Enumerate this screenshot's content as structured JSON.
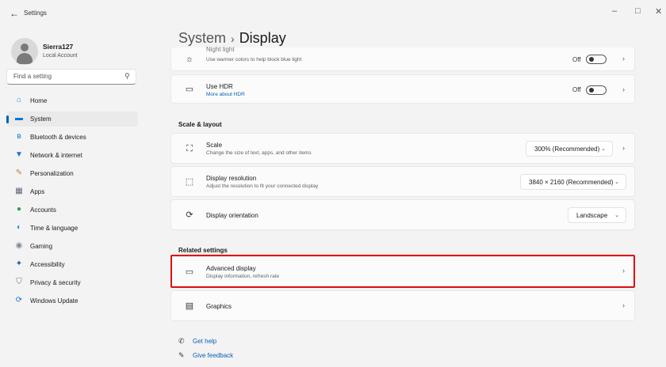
{
  "window": {
    "title": "Settings",
    "back_glyph": "←",
    "minimize_glyph": "–",
    "maximize_glyph": "□",
    "close_glyph": "✕"
  },
  "user": {
    "name": "Sierra127",
    "account_type": "Local Account"
  },
  "search": {
    "placeholder": "Find a setting",
    "value": ""
  },
  "sidebar": {
    "items": [
      {
        "label": "Home",
        "icon": "home-icon",
        "glyph": "⌂",
        "color": "#3a7bd5"
      },
      {
        "label": "System",
        "icon": "system-icon",
        "glyph": "▬",
        "color": "#0a78d4",
        "active": true
      },
      {
        "label": "Bluetooth & devices",
        "icon": "bluetooth-icon",
        "glyph": "ʙ",
        "color": "#0a78d4"
      },
      {
        "label": "Network & internet",
        "icon": "wifi-icon",
        "glyph": "▼",
        "color": "#1f6fd1"
      },
      {
        "label": "Personalization",
        "icon": "brush-icon",
        "glyph": "✎",
        "color": "#c0863a"
      },
      {
        "label": "Apps",
        "icon": "apps-icon",
        "glyph": "▦",
        "color": "#5a6575"
      },
      {
        "label": "Accounts",
        "icon": "accounts-icon",
        "glyph": "●",
        "color": "#2d9d5a"
      },
      {
        "label": "Time & language",
        "icon": "globe-icon",
        "glyph": "◐",
        "color": "#2a8fc7"
      },
      {
        "label": "Gaming",
        "icon": "gamepad-icon",
        "glyph": "◉",
        "color": "#7c8794"
      },
      {
        "label": "Accessibility",
        "icon": "accessibility-icon",
        "glyph": "✦",
        "color": "#1a5fb4"
      },
      {
        "label": "Privacy & security",
        "icon": "shield-icon",
        "glyph": "⛉",
        "color": "#6b7480"
      },
      {
        "label": "Windows Update",
        "icon": "update-icon",
        "glyph": "⟳",
        "color": "#1a73c7"
      }
    ]
  },
  "page": {
    "breadcrumb": "System",
    "separator": "›",
    "title": "Display"
  },
  "cards": {
    "night_light": {
      "title": "Night light",
      "subtitle": "Use warmer colors to help block blue light",
      "state": "Off",
      "icon_glyph": "☼"
    },
    "hdr": {
      "title": "Use HDR",
      "link": "More about HDR",
      "state": "Off",
      "icon_glyph": "▭"
    },
    "scale": {
      "title": "Scale",
      "subtitle": "Change the size of text, apps, and other items",
      "value": "300% (Recommended)",
      "icon_glyph": "⛶"
    },
    "resolution": {
      "title": "Display resolution",
      "subtitle": "Adjust the resolution to fit your connected display",
      "value": "3840 × 2160 (Recommended)",
      "icon_glyph": "⬚"
    },
    "orientation": {
      "title": "Display orientation",
      "value": "Landscape",
      "icon_glyph": "⟳"
    },
    "advanced": {
      "title": "Advanced display",
      "subtitle": "Display information, refresh rate",
      "icon_glyph": "▭"
    },
    "graphics": {
      "title": "Graphics",
      "icon_glyph": "▤"
    }
  },
  "sections": {
    "scale_layout": "Scale & layout",
    "related": "Related settings"
  },
  "help": {
    "get_help": "Get help",
    "give_feedback": "Give feedback"
  },
  "glyphs": {
    "chevron_right": "›",
    "chevron_down": "⌄",
    "search": "⚲"
  },
  "colors": {
    "accent": "#005fb8",
    "link": "#0a5fb3",
    "highlight_border": "#e01010"
  }
}
